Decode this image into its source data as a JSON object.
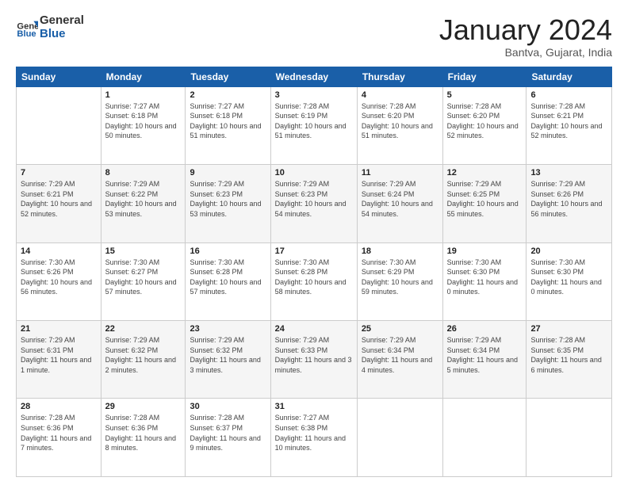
{
  "header": {
    "logo_general": "General",
    "logo_blue": "Blue",
    "month_title": "January 2024",
    "subtitle": "Bantva, Gujarat, India"
  },
  "days_of_week": [
    "Sunday",
    "Monday",
    "Tuesday",
    "Wednesday",
    "Thursday",
    "Friday",
    "Saturday"
  ],
  "weeks": [
    [
      {
        "day": "",
        "sunrise": "",
        "sunset": "",
        "daylight": ""
      },
      {
        "day": "1",
        "sunrise": "7:27 AM",
        "sunset": "6:18 PM",
        "daylight": "10 hours and 50 minutes."
      },
      {
        "day": "2",
        "sunrise": "7:27 AM",
        "sunset": "6:18 PM",
        "daylight": "10 hours and 51 minutes."
      },
      {
        "day": "3",
        "sunrise": "7:28 AM",
        "sunset": "6:19 PM",
        "daylight": "10 hours and 51 minutes."
      },
      {
        "day": "4",
        "sunrise": "7:28 AM",
        "sunset": "6:20 PM",
        "daylight": "10 hours and 51 minutes."
      },
      {
        "day": "5",
        "sunrise": "7:28 AM",
        "sunset": "6:20 PM",
        "daylight": "10 hours and 52 minutes."
      },
      {
        "day": "6",
        "sunrise": "7:28 AM",
        "sunset": "6:21 PM",
        "daylight": "10 hours and 52 minutes."
      }
    ],
    [
      {
        "day": "7",
        "sunrise": "7:29 AM",
        "sunset": "6:21 PM",
        "daylight": "10 hours and 52 minutes."
      },
      {
        "day": "8",
        "sunrise": "7:29 AM",
        "sunset": "6:22 PM",
        "daylight": "10 hours and 53 minutes."
      },
      {
        "day": "9",
        "sunrise": "7:29 AM",
        "sunset": "6:23 PM",
        "daylight": "10 hours and 53 minutes."
      },
      {
        "day": "10",
        "sunrise": "7:29 AM",
        "sunset": "6:23 PM",
        "daylight": "10 hours and 54 minutes."
      },
      {
        "day": "11",
        "sunrise": "7:29 AM",
        "sunset": "6:24 PM",
        "daylight": "10 hours and 54 minutes."
      },
      {
        "day": "12",
        "sunrise": "7:29 AM",
        "sunset": "6:25 PM",
        "daylight": "10 hours and 55 minutes."
      },
      {
        "day": "13",
        "sunrise": "7:29 AM",
        "sunset": "6:26 PM",
        "daylight": "10 hours and 56 minutes."
      }
    ],
    [
      {
        "day": "14",
        "sunrise": "7:30 AM",
        "sunset": "6:26 PM",
        "daylight": "10 hours and 56 minutes."
      },
      {
        "day": "15",
        "sunrise": "7:30 AM",
        "sunset": "6:27 PM",
        "daylight": "10 hours and 57 minutes."
      },
      {
        "day": "16",
        "sunrise": "7:30 AM",
        "sunset": "6:28 PM",
        "daylight": "10 hours and 57 minutes."
      },
      {
        "day": "17",
        "sunrise": "7:30 AM",
        "sunset": "6:28 PM",
        "daylight": "10 hours and 58 minutes."
      },
      {
        "day": "18",
        "sunrise": "7:30 AM",
        "sunset": "6:29 PM",
        "daylight": "10 hours and 59 minutes."
      },
      {
        "day": "19",
        "sunrise": "7:30 AM",
        "sunset": "6:30 PM",
        "daylight": "11 hours and 0 minutes."
      },
      {
        "day": "20",
        "sunrise": "7:30 AM",
        "sunset": "6:30 PM",
        "daylight": "11 hours and 0 minutes."
      }
    ],
    [
      {
        "day": "21",
        "sunrise": "7:29 AM",
        "sunset": "6:31 PM",
        "daylight": "11 hours and 1 minute."
      },
      {
        "day": "22",
        "sunrise": "7:29 AM",
        "sunset": "6:32 PM",
        "daylight": "11 hours and 2 minutes."
      },
      {
        "day": "23",
        "sunrise": "7:29 AM",
        "sunset": "6:32 PM",
        "daylight": "11 hours and 3 minutes."
      },
      {
        "day": "24",
        "sunrise": "7:29 AM",
        "sunset": "6:33 PM",
        "daylight": "11 hours and 3 minutes."
      },
      {
        "day": "25",
        "sunrise": "7:29 AM",
        "sunset": "6:34 PM",
        "daylight": "11 hours and 4 minutes."
      },
      {
        "day": "26",
        "sunrise": "7:29 AM",
        "sunset": "6:34 PM",
        "daylight": "11 hours and 5 minutes."
      },
      {
        "day": "27",
        "sunrise": "7:28 AM",
        "sunset": "6:35 PM",
        "daylight": "11 hours and 6 minutes."
      }
    ],
    [
      {
        "day": "28",
        "sunrise": "7:28 AM",
        "sunset": "6:36 PM",
        "daylight": "11 hours and 7 minutes."
      },
      {
        "day": "29",
        "sunrise": "7:28 AM",
        "sunset": "6:36 PM",
        "daylight": "11 hours and 8 minutes."
      },
      {
        "day": "30",
        "sunrise": "7:28 AM",
        "sunset": "6:37 PM",
        "daylight": "11 hours and 9 minutes."
      },
      {
        "day": "31",
        "sunrise": "7:27 AM",
        "sunset": "6:38 PM",
        "daylight": "11 hours and 10 minutes."
      },
      {
        "day": "",
        "sunrise": "",
        "sunset": "",
        "daylight": ""
      },
      {
        "day": "",
        "sunrise": "",
        "sunset": "",
        "daylight": ""
      },
      {
        "day": "",
        "sunrise": "",
        "sunset": "",
        "daylight": ""
      }
    ]
  ],
  "labels": {
    "sunrise": "Sunrise:",
    "sunset": "Sunset:",
    "daylight": "Daylight:"
  }
}
